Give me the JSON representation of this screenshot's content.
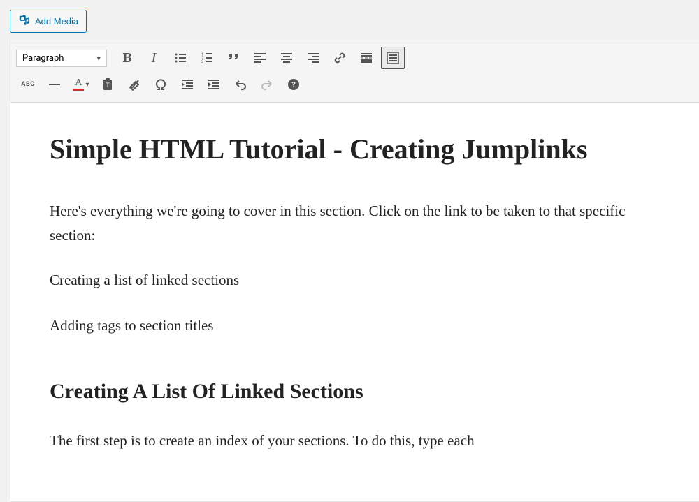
{
  "top": {
    "add_media_label": "Add Media"
  },
  "toolbar": {
    "format_select": "Paragraph"
  },
  "content": {
    "h1": "Simple HTML Tutorial - Creating Jumplinks",
    "p1": "Here's everything we're going to cover in this section. Click on the link to be taken to that specific section:",
    "p2": "Creating a list of linked sections",
    "p3": "Adding tags to section titles",
    "h2": "Creating A List Of Linked Sections",
    "p4": "The first step is to create an index of your sections. To do this, type each"
  }
}
